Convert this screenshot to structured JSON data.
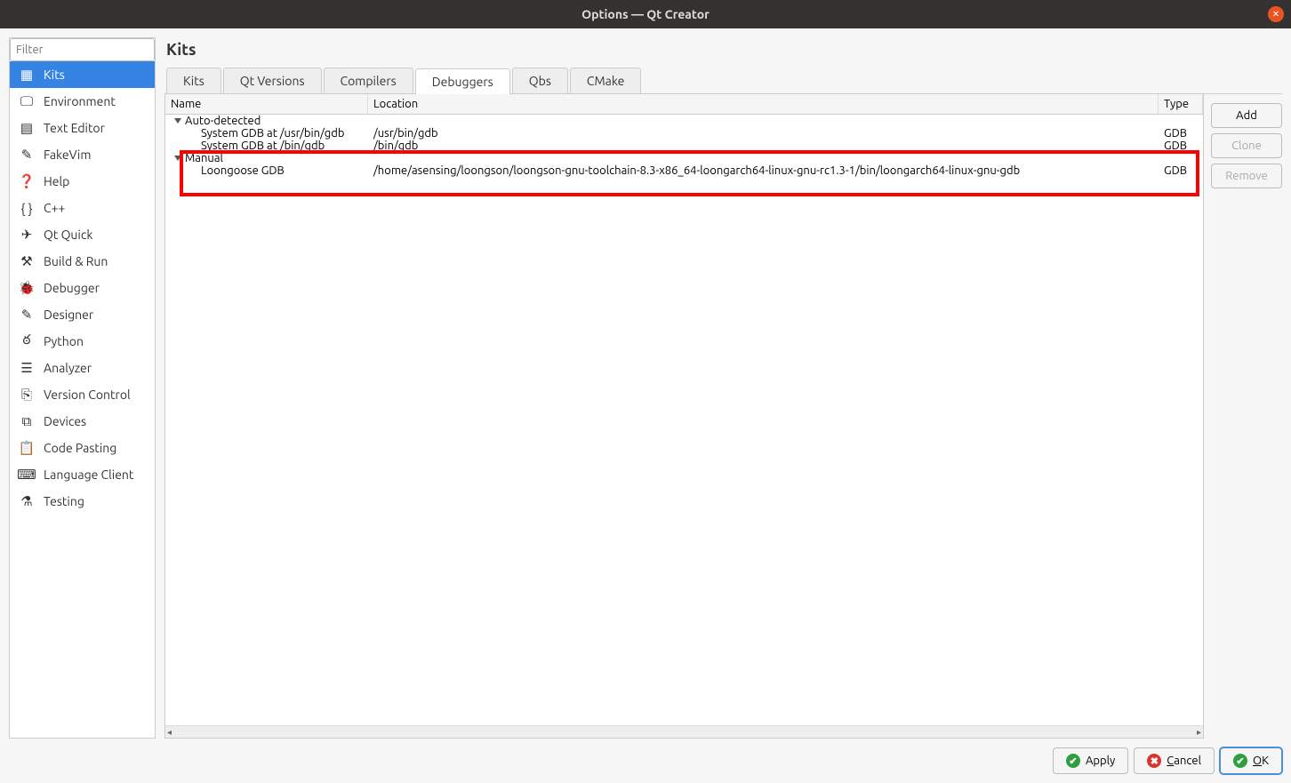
{
  "window": {
    "title": "Options — Qt Creator"
  },
  "sidebar": {
    "filter_placeholder": "Filter",
    "items": [
      {
        "label": "Kits",
        "icon": "kits-icon",
        "glyph": "▦",
        "selected": true
      },
      {
        "label": "Environment",
        "icon": "environment-icon",
        "glyph": "🖵"
      },
      {
        "label": "Text Editor",
        "icon": "text-editor-icon",
        "glyph": "▤"
      },
      {
        "label": "FakeVim",
        "icon": "fakevim-icon",
        "glyph": "✎"
      },
      {
        "label": "Help",
        "icon": "help-icon",
        "glyph": "❓"
      },
      {
        "label": "C++",
        "icon": "cpp-icon",
        "glyph": "{ }"
      },
      {
        "label": "Qt Quick",
        "icon": "qtquick-icon",
        "glyph": "✈"
      },
      {
        "label": "Build & Run",
        "icon": "build-run-icon",
        "glyph": "⚒"
      },
      {
        "label": "Debugger",
        "icon": "debugger-icon",
        "glyph": "🐞"
      },
      {
        "label": "Designer",
        "icon": "designer-icon",
        "glyph": "✎"
      },
      {
        "label": "Python",
        "icon": "python-icon",
        "glyph": "ఠ"
      },
      {
        "label": "Analyzer",
        "icon": "analyzer-icon",
        "glyph": "☰"
      },
      {
        "label": "Version Control",
        "icon": "version-control-icon",
        "glyph": "⎘"
      },
      {
        "label": "Devices",
        "icon": "devices-icon",
        "glyph": "⧉"
      },
      {
        "label": "Code Pasting",
        "icon": "code-pasting-icon",
        "glyph": "📋"
      },
      {
        "label": "Language Client",
        "icon": "language-client-icon",
        "glyph": "⌨"
      },
      {
        "label": "Testing",
        "icon": "testing-icon",
        "glyph": "⚗"
      }
    ]
  },
  "page": {
    "title": "Kits"
  },
  "tabs": [
    {
      "label": "Kits"
    },
    {
      "label": "Qt Versions"
    },
    {
      "label": "Compilers"
    },
    {
      "label": "Debuggers",
      "active": true
    },
    {
      "label": "Qbs"
    },
    {
      "label": "CMake"
    }
  ],
  "table": {
    "columns": {
      "name": "Name",
      "location": "Location",
      "type": "Type"
    },
    "groups": [
      {
        "label": "Auto-detected",
        "rows": [
          {
            "name": "System GDB at /usr/bin/gdb",
            "location": "/usr/bin/gdb",
            "type": "GDB"
          },
          {
            "name": "System GDB at /bin/gdb",
            "location": "/bin/gdb",
            "type": "GDB"
          }
        ]
      },
      {
        "label": "Manual",
        "highlight": true,
        "rows": [
          {
            "name": "Loongoose GDB",
            "location": "/home/asensing/loongson/loongson-gnu-toolchain-8.3-x86_64-loongarch64-linux-gnu-rc1.3-1/bin/loongarch64-linux-gnu-gdb",
            "type": "GDB"
          }
        ]
      }
    ]
  },
  "side_buttons": {
    "add": "Add",
    "clone": "Clone",
    "remove": "Remove"
  },
  "bottom": {
    "apply": "Apply",
    "cancel": "Cancel",
    "ok": "OK",
    "cancel_mn": "C",
    "ok_mn": "O"
  }
}
